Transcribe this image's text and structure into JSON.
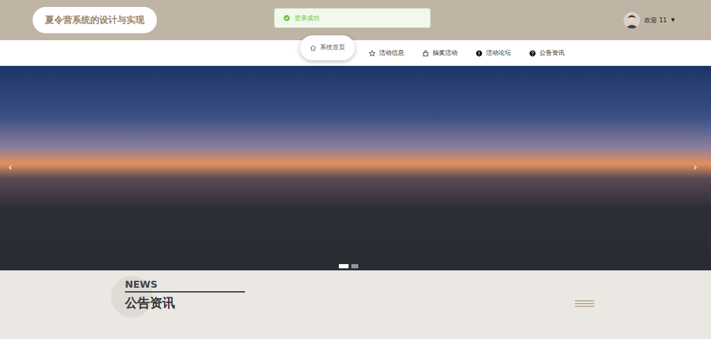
{
  "header": {
    "title": "夏令营系统的设计与实现",
    "welcome": "欢迎 11",
    "caret": "▼"
  },
  "toast": {
    "message": "登录成功"
  },
  "nav": [
    {
      "label": "系统首页",
      "selected": true,
      "icon": "home"
    },
    {
      "label": "活动信息",
      "selected": false,
      "icon": "star"
    },
    {
      "label": "抽奖活动",
      "selected": false,
      "icon": "bag"
    },
    {
      "label": "活动论坛",
      "selected": false,
      "icon": "alert"
    },
    {
      "label": "公告资讯",
      "selected": false,
      "icon": "help"
    }
  ],
  "banner": {
    "prev": "‹",
    "next": "›",
    "slides": [
      {
        "selected": true
      },
      {
        "selected": false
      }
    ]
  },
  "news": {
    "kicker": "NEWS",
    "title": "公告资讯"
  }
}
